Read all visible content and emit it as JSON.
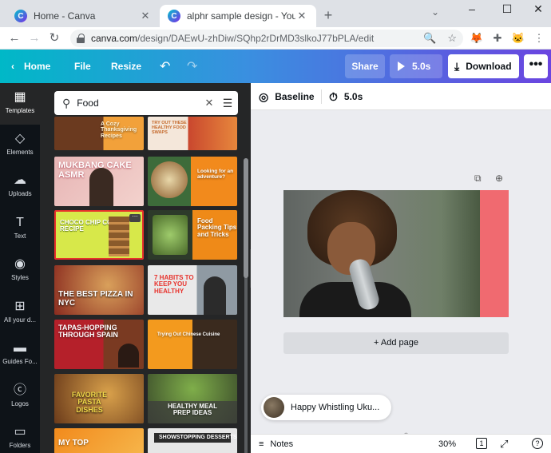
{
  "browser": {
    "tabs": [
      {
        "title": "Home - Canva",
        "active": false
      },
      {
        "title": "alphr sample design - YouTube T",
        "active": true
      }
    ],
    "new_tab": "+",
    "url_host": "canva.com",
    "url_path": "/design/DAEwU-zhDiw/SQhp2rDrMD3slkoJ77bPLA/edit"
  },
  "header": {
    "home": "Home",
    "file": "File",
    "resize": "Resize",
    "share": "Share",
    "play_duration": "5.0s",
    "download": "Download",
    "more": "•••",
    "gradient_start": "#00b8c7",
    "gradient_end": "#6a45e0"
  },
  "rail": [
    {
      "label": "Templates",
      "icon": "templates-icon",
      "active": true
    },
    {
      "label": "Elements",
      "icon": "elements-icon",
      "active": false
    },
    {
      "label": "Uploads",
      "icon": "uploads-icon",
      "active": false
    },
    {
      "label": "Text",
      "icon": "text-icon",
      "active": false
    },
    {
      "label": "Styles",
      "icon": "styles-icon",
      "active": false
    },
    {
      "label": "All your d...",
      "icon": "all-designs-icon",
      "active": false
    },
    {
      "label": "Guides Fo...",
      "icon": "guides-icon",
      "active": false
    },
    {
      "label": "Logos",
      "icon": "logos-icon",
      "active": false
    },
    {
      "label": "Folders",
      "icon": "folders-icon",
      "active": false
    }
  ],
  "search": {
    "value": "Food"
  },
  "templates": [
    {
      "caption": "A Cozy Thanksgiving Recipes"
    },
    {
      "caption": "TRY OUT THESE HEALTHY FOOD SWAPS"
    },
    {
      "caption": "MUKBANG CAKE ASMR"
    },
    {
      "caption": "Looking for an adventure?"
    },
    {
      "caption": "CHOCO CHIP COOKIE RECIPE"
    },
    {
      "caption": "Food Packing Tips and Tricks"
    },
    {
      "caption": "THE BEST PIZZA IN NYC"
    },
    {
      "caption": "7 HABITS TO KEEP YOU HEALTHY"
    },
    {
      "caption": "TAPAS-HOPPING THROUGH SPAIN"
    },
    {
      "caption": "Trying Out Chinese Cuisine"
    },
    {
      "caption": "FAVORITE PASTA DISHES"
    },
    {
      "caption": "HEALTHY MEAL PREP IDEAS"
    },
    {
      "caption": "MY TOP"
    },
    {
      "caption": "SHOWSTOPPING DESSERTS"
    }
  ],
  "toolbar": {
    "baseline": "Baseline",
    "duration": "5.0s"
  },
  "editor": {
    "add_page": "+ Add page",
    "audio_title": "Happy Whistling Uku...",
    "notes": "Notes",
    "zoom": "30%",
    "page_count": "1"
  }
}
